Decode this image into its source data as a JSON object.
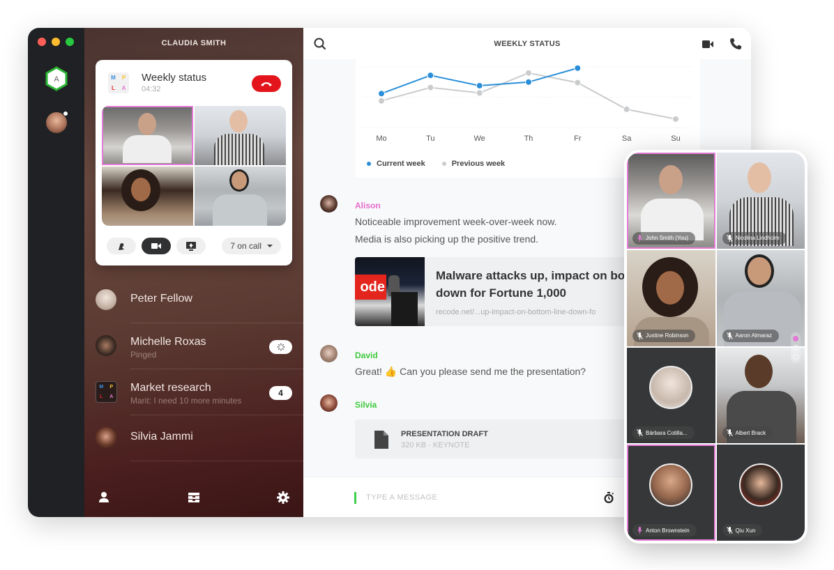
{
  "window": {
    "traffic_lights": [
      "#ff5f57",
      "#febc2e",
      "#28c840"
    ],
    "workspace_badge": "A",
    "rail_avatar_status": "online"
  },
  "sidebar": {
    "title": "CLAUDIA SMITH",
    "call_card": {
      "group_initials": [
        "M",
        "P",
        "L",
        "A"
      ],
      "title": "Weekly status",
      "timer": "04:32",
      "participants_count_label": "7 on call",
      "controls": [
        "raise-hand",
        "video",
        "share-screen"
      ]
    },
    "contacts": [
      {
        "name": "Peter Fellow",
        "subtitle": "",
        "badge": ""
      },
      {
        "name": "Michelle Roxas",
        "subtitle": "Pinged",
        "badge": "loading"
      },
      {
        "name": "Market research",
        "subtitle": "Marit: I need 10 more minutes",
        "badge": "4"
      },
      {
        "name": "Silvia Jammi",
        "subtitle": "",
        "badge": ""
      }
    ],
    "bottom_nav": [
      "profile",
      "inbox",
      "settings"
    ]
  },
  "main": {
    "title": "WEEKLY STATUS",
    "messages": [
      {
        "author": "Alison",
        "author_color": "#e56ccc",
        "lines": [
          "Noticeable improvement week-over-week now.",
          "Media is also picking up the positive trend."
        ]
      },
      {
        "author": "David",
        "author_color": "#3ec93e",
        "lines": [
          "Great! 👍 Can you please send me the presentation?"
        ]
      },
      {
        "author": "Silvia",
        "author_color": "#3ec93e",
        "lines": []
      }
    ],
    "link_preview": {
      "title_line1": "Malware attacks up, impact on bott",
      "title_line2": "down for Fortune 1,000",
      "url": "recode.net/...up-impact-on-bottom-line-down-fo",
      "image_text": "ode"
    },
    "file": {
      "name": "PRESENTATION DRAFT",
      "size": "320 KB",
      "type": "KEYNOTE"
    },
    "composer": {
      "placeholder": "TYPE A MESSAGE",
      "value": ""
    }
  },
  "chart_data": {
    "type": "line",
    "title": "",
    "categories": [
      "Mo",
      "Tu",
      "We",
      "Th",
      "Fr",
      "Sa",
      "Su"
    ],
    "series": [
      {
        "name": "Current week",
        "color": "#2a8fd8",
        "values": [
          56,
          86,
          69,
          75,
          98,
          null,
          null
        ]
      },
      {
        "name": "Previous week",
        "color": "#c9cbcd",
        "values": [
          44,
          66,
          57,
          90,
          74,
          30,
          14
        ]
      }
    ],
    "ylim": [
      0,
      100
    ],
    "grid": true,
    "legend": "bottom-left",
    "xlabel": "",
    "ylabel": ""
  },
  "phone": {
    "participants": [
      {
        "name": "John Smith (You)",
        "mic": "speaking",
        "active": true
      },
      {
        "name": "Nicolina Lindholm",
        "mic": "muted",
        "active": false
      },
      {
        "name": "Justine Robinson",
        "mic": "muted",
        "active": false
      },
      {
        "name": "Aaron Almaraz",
        "mic": "muted",
        "active": false
      },
      {
        "name": "Bárbara Cotilla...",
        "mic": "muted",
        "active": false
      },
      {
        "name": "Albert Brack",
        "mic": "muted",
        "active": false
      },
      {
        "name": "Anton Brownstein",
        "mic": "speaking",
        "active": true
      },
      {
        "name": "Qiu Xun",
        "mic": "muted",
        "active": false
      }
    ],
    "pager": {
      "pages": 3,
      "current": 1
    },
    "accent": "#e27ad6"
  }
}
